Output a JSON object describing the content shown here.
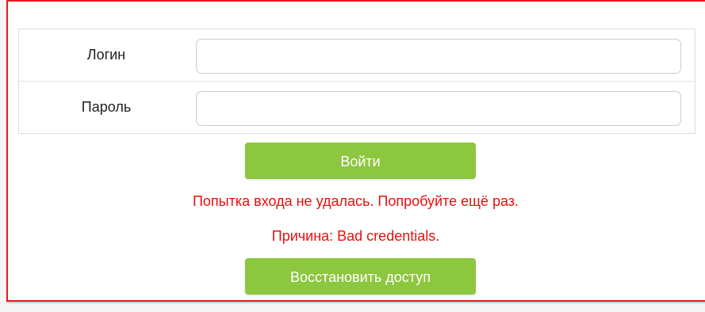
{
  "form": {
    "login_label": "Логин",
    "login_value": "",
    "password_label": "Пароль",
    "password_value": "",
    "submit_label": "Войти"
  },
  "messages": {
    "error": "Попытка входа не удалась. Попробуйте ещё раз.",
    "reason": "Причина: Bad credentials."
  },
  "recover": {
    "label": "Восстановить доступ"
  },
  "colors": {
    "accent": "#8dc63f",
    "error": "#ea0e0e",
    "frame": "#e8181d"
  }
}
